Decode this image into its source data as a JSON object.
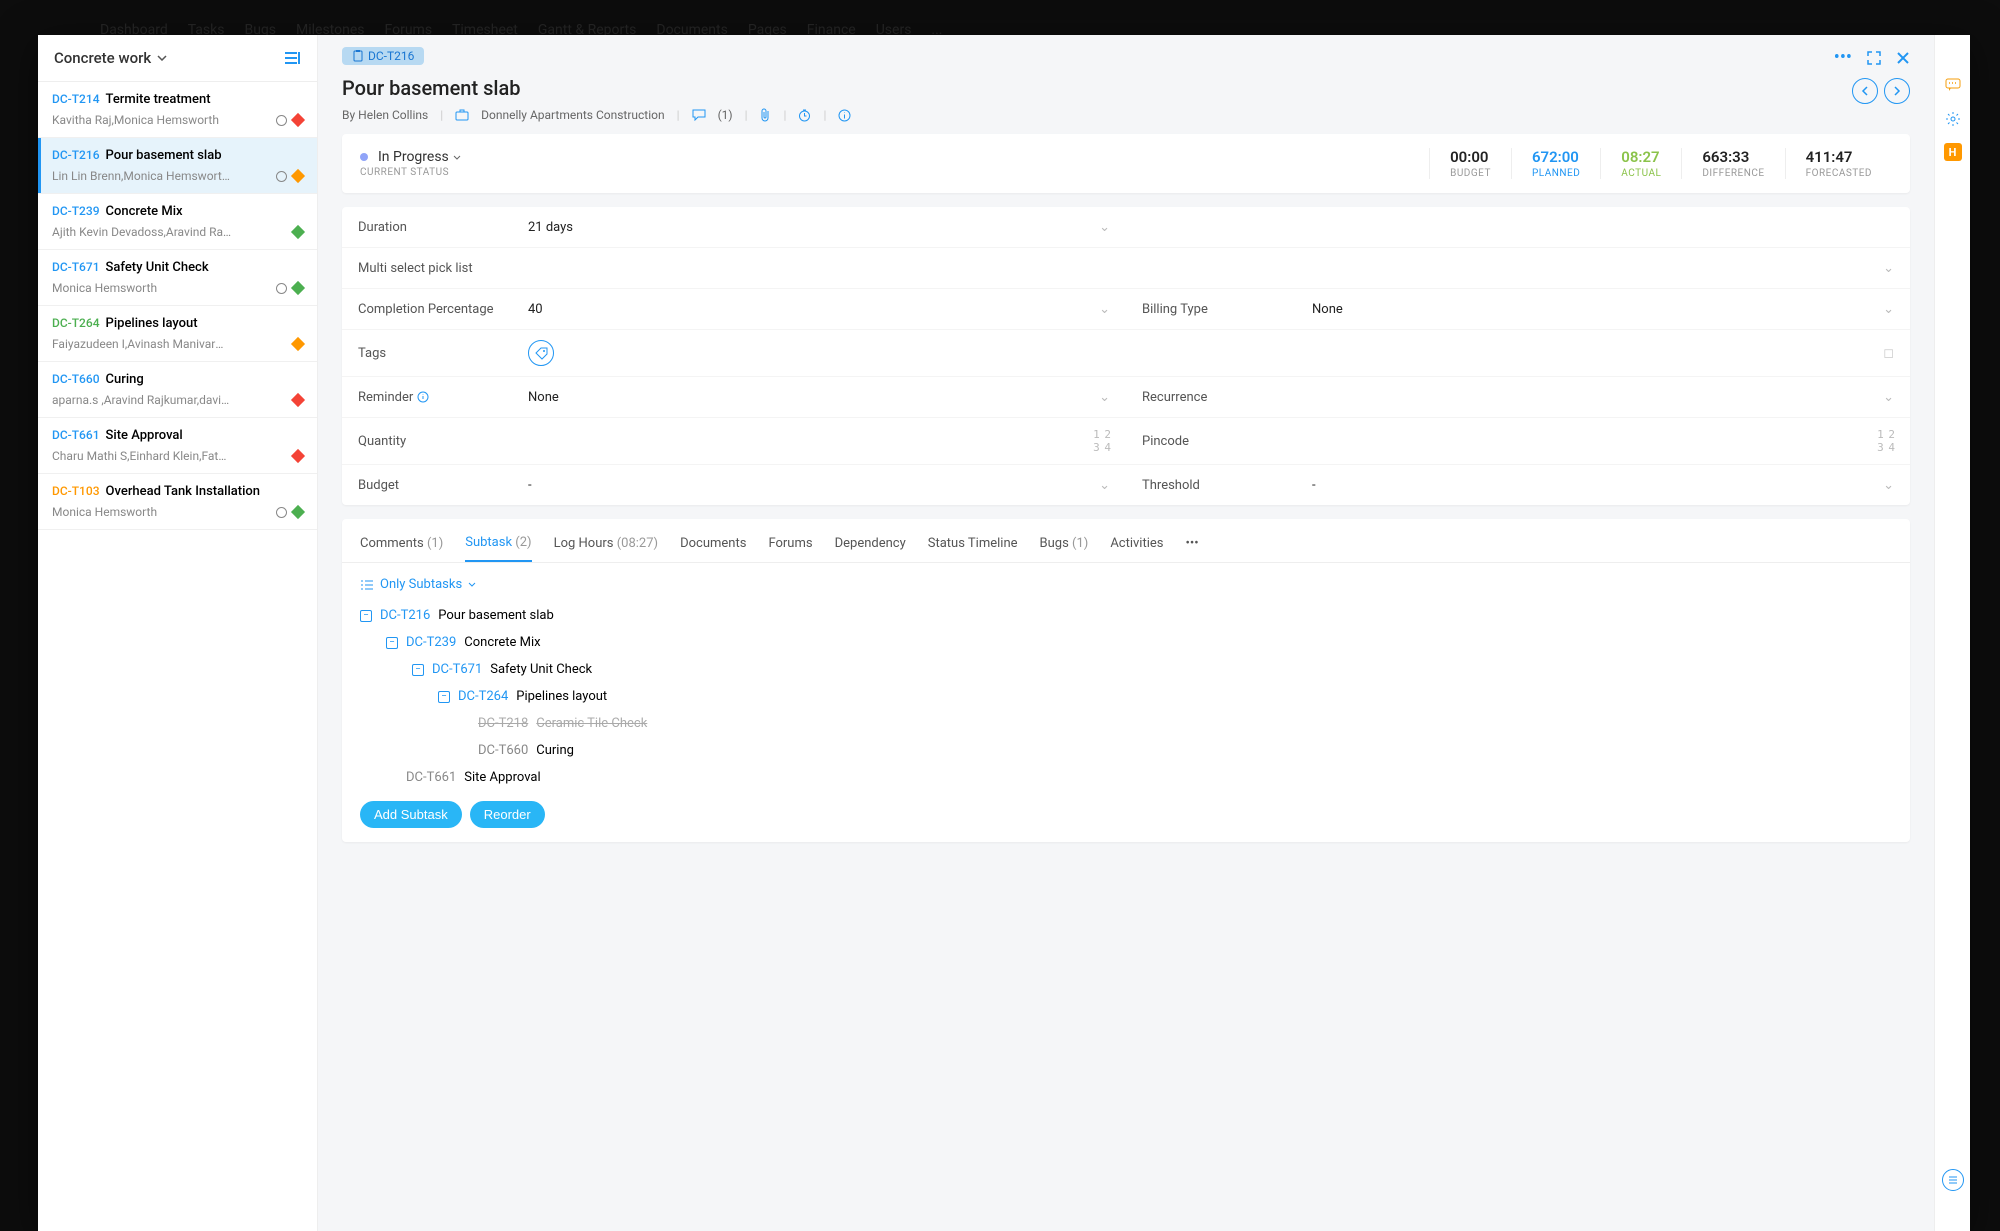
{
  "backdrop_nav": [
    "Dashboard",
    "Tasks",
    "Bugs",
    "Milestones",
    "Forums",
    "Timesheet",
    "Gantt & Reports",
    "Documents",
    "Pages",
    "Finance",
    "Users",
    "..."
  ],
  "sidebar": {
    "title": "Concrete work",
    "tasks": [
      {
        "id": "DC-T214",
        "title": "Termite treatment",
        "assignees": "Kavitha Raj,Monica Hemsworth",
        "timer": true,
        "diamond": "d-red"
      },
      {
        "id": "DC-T216",
        "title": "Pour basement slab",
        "assignees": "Lin Lin Brenn,Monica Hemsworth,Amrit...",
        "timer": true,
        "diamond": "d-amber",
        "active": true
      },
      {
        "id": "DC-T239",
        "title": "Concrete Mix",
        "assignees": "Ajith Kevin Devadoss,Aravind Rajkumar",
        "timer": false,
        "diamond": "d-green"
      },
      {
        "id": "DC-T671",
        "title": "Safety Unit Check",
        "assignees": "Monica Hemsworth",
        "timer": true,
        "diamond": "d-green"
      },
      {
        "id": "DC-T264",
        "title": "Pipelines layout",
        "assignees": "Faiyazudeen I,Avinash Manivarman",
        "timer": false,
        "diamond": "d-amber",
        "idclass": "idcolor-green"
      },
      {
        "id": "DC-T660",
        "title": "Curing",
        "assignees": "aparna.s ,Aravind Rajkumar,davidh",
        "timer": false,
        "diamond": "d-red"
      },
      {
        "id": "DC-T661",
        "title": "Site Approval",
        "assignees": "Charu Mathi S,Einhard Klein,Fathima Yilmaz",
        "timer": false,
        "diamond": "d-red"
      },
      {
        "id": "DC-T103",
        "title": "Overhead Tank Installation",
        "assignees": "Monica Hemsworth",
        "timer": true,
        "diamond": "d-green",
        "idclass": "idcolor-amber"
      }
    ]
  },
  "detail": {
    "pill_id": "DC-T216",
    "title": "Pour basement slab",
    "by_prefix": "By ",
    "by": "Helen Collins",
    "project": "Donnelly Apartments Construction",
    "comments_meta": "(1)",
    "status": "In Progress",
    "status_caption": "CURRENT STATUS",
    "metrics": [
      {
        "val": "00:00",
        "lab": "BUDGET"
      },
      {
        "val": "672:00",
        "lab": "PLANNED",
        "cls": "m-planned"
      },
      {
        "val": "08:27",
        "lab": "ACTUAL",
        "cls": "m-actual"
      },
      {
        "val": "663:33",
        "lab": "DIFFERENCE"
      },
      {
        "val": "411:47",
        "lab": "FORECASTED"
      }
    ],
    "fields": {
      "duration_label": "Duration",
      "duration_value": "21  days",
      "multi_label": "Multi select pick list",
      "completion_label": "Completion Percentage",
      "completion_value": "40",
      "billing_label": "Billing Type",
      "billing_value": "None",
      "tags_label": "Tags",
      "reminder_label": "Reminder",
      "reminder_value": "None",
      "recurrence_label": "Recurrence",
      "quantity_label": "Quantity",
      "pincode_label": "Pincode",
      "budget_label": "Budget",
      "budget_value": "-",
      "threshold_label": "Threshold",
      "threshold_value": "-"
    }
  },
  "tabs": {
    "items": [
      {
        "label": "Comments",
        "extra": "(1)"
      },
      {
        "label": "Subtask",
        "extra": "(2)",
        "active": true
      },
      {
        "label": "Log Hours",
        "extra": "(08:27)"
      },
      {
        "label": "Documents"
      },
      {
        "label": "Forums"
      },
      {
        "label": "Dependency"
      },
      {
        "label": "Status Timeline"
      },
      {
        "label": "Bugs",
        "extra": "(1)"
      },
      {
        "label": "Activities"
      }
    ],
    "filter_label": "Only Subtasks",
    "tree": [
      {
        "indent": 0,
        "id": "DC-T216",
        "title": "Pour basement slab",
        "toggle": true,
        "link": true
      },
      {
        "indent": 1,
        "id": "DC-T239",
        "title": "Concrete Mix",
        "toggle": true,
        "link": true
      },
      {
        "indent": 2,
        "id": "DC-T671",
        "title": "Safety Unit Check",
        "toggle": true,
        "link": true
      },
      {
        "indent": 3,
        "id": "DC-T264",
        "title": "Pipelines layout",
        "toggle": true,
        "link": true
      },
      {
        "indent": 4,
        "id": "DC-T218",
        "title": "Ceramic Tile Check",
        "strike": true
      },
      {
        "indent": 4,
        "id": "DC-T660",
        "title": "Curing"
      },
      {
        "indent": 1,
        "id": "DC-T661",
        "title": "Site Approval"
      }
    ],
    "add_btn": "Add Subtask",
    "reorder_btn": "Reorder"
  }
}
